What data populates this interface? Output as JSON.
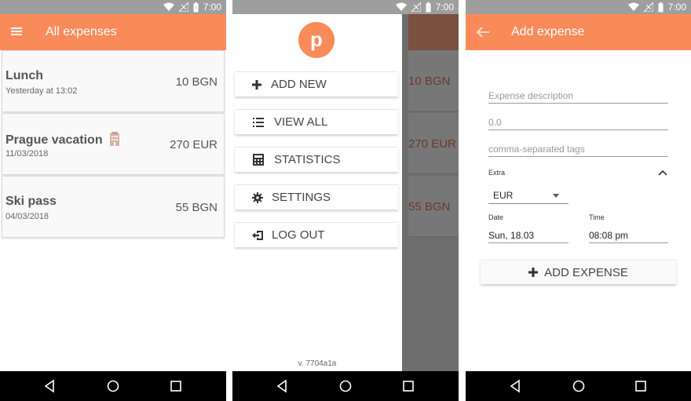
{
  "status_bar": {
    "time": "7:00"
  },
  "colors": {
    "accent": "#f98b5b",
    "status_bar": "#9e9e9e",
    "nav_bar": "#000000"
  },
  "screen1": {
    "title": "All expenses",
    "items": [
      {
        "name": "Lunch",
        "date": "Yesterday at 13:02",
        "amount": "10 BGN"
      },
      {
        "name": "Prague vacation",
        "date": "11/03/2018",
        "amount": "270 EUR"
      },
      {
        "name": "Ski pass",
        "date": "04/03/2018",
        "amount": "55 BGN"
      }
    ]
  },
  "screen2": {
    "logo_letter": "p",
    "menu": [
      {
        "label": "ADD NEW",
        "icon": "plus-icon"
      },
      {
        "label": "VIEW ALL",
        "icon": "list-icon"
      },
      {
        "label": "STATISTICS",
        "icon": "calculator-icon"
      },
      {
        "label": "SETTINGS",
        "icon": "gear-icon"
      },
      {
        "label": "LOG OUT",
        "icon": "logout-icon"
      }
    ],
    "version": "v. 7704a1a",
    "behind_amounts": [
      "10 BGN",
      "270 EUR",
      "55 BGN"
    ]
  },
  "screen3": {
    "title": "Add expense",
    "description_placeholder": "Expense description",
    "amount_placeholder": "0.0",
    "tags_placeholder": "comma-separated tags",
    "extra_label": "Extra",
    "currency": "EUR",
    "date_label": "Date",
    "date_value": "Sun, 18.03",
    "time_label": "Time",
    "time_value": "08:08 pm",
    "add_button": "ADD EXPENSE"
  }
}
